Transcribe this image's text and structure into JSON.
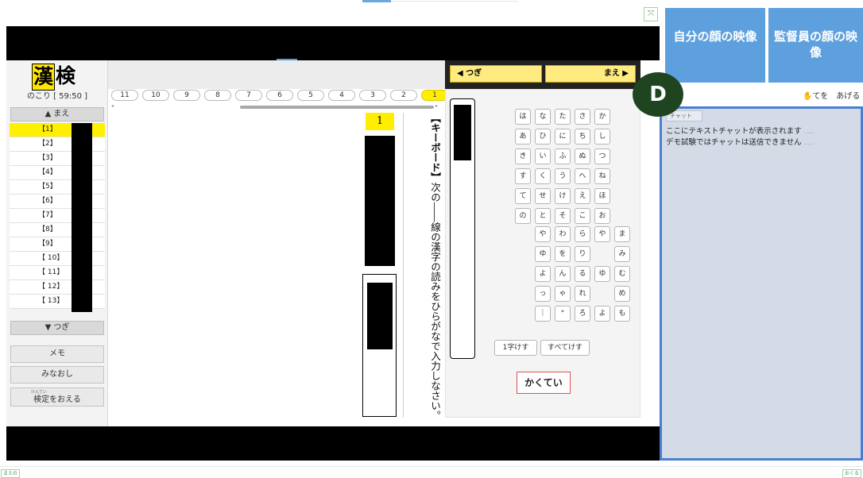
{
  "header": {
    "expand_icon": "⤧"
  },
  "left": {
    "logo": [
      "漢",
      "検"
    ],
    "timer": "のこり [ 59:50 ]",
    "prev_label": "▲ まえ",
    "next_label": "▼ つぎ",
    "questions": [
      "【1】",
      "【2】",
      "【3】",
      "【4】",
      "【5】",
      "【6】",
      "【7】",
      "【8】",
      "【9】",
      "【 10】",
      "【 11】",
      "【 12】",
      "【 13】"
    ],
    "memo_label": "メモ",
    "review_label": "みなおし",
    "finish_ruby": "けんてい",
    "finish_label": "検定をおえる"
  },
  "tabs": [
    "11",
    "10",
    "9",
    "8",
    "7",
    "6",
    "5",
    "4",
    "3",
    "2",
    "1"
  ],
  "question": {
    "number": "1",
    "keyboard_tag": "【キーボード】",
    "instruction": "次の――線の漢字の読みをひらがなで入力しなさい。"
  },
  "keyboard": {
    "next_label": "◀ つぎ",
    "prev_label": "まえ ▶",
    "rows_top": [
      [
        "は",
        "な",
        "た",
        "さ",
        "か",
        "あ"
      ],
      [
        "ひ",
        "に",
        "ち",
        "し",
        "き",
        "い"
      ],
      [
        "ふ",
        "ぬ",
        "つ",
        "す",
        "く",
        "う"
      ],
      [
        "へ",
        "ね",
        "て",
        "せ",
        "け",
        "え"
      ],
      [
        "ほ",
        "の",
        "と",
        "そ",
        "こ",
        "お"
      ]
    ],
    "rows_bottom": [
      [
        "や",
        "わ",
        "ら",
        "や",
        "ま"
      ],
      [
        "ゆ",
        "を",
        "り",
        "",
        "み"
      ],
      [
        "よ",
        "ん",
        "る",
        "ゆ",
        "む"
      ],
      [
        "っ",
        "ゃ",
        "れ",
        "",
        "め"
      ],
      [
        "｜",
        "°",
        "ろ",
        "よ",
        "も"
      ]
    ],
    "delete_one": "1字けす",
    "delete_all": "すべてけす",
    "confirm": "かくてい"
  },
  "right": {
    "video_self": "自分の顔の映像",
    "video_proctor": "監督員の顔の映像",
    "raise_hand": "✋てを　あげる",
    "badge": "D",
    "chat_tab": "チャット",
    "chat_lines": [
      "ここにテキストチャットが表示されます",
      "デモ試験ではチャットは送信できません"
    ],
    "chat_dots": "......"
  },
  "footer": {
    "left_btn": "まえの",
    "right_btn": "おくる"
  },
  "colors": {
    "accent_yellow": "#ffee00",
    "video_blue": "#5ea0dd",
    "chat_border": "#4a7fd0",
    "badge_green": "#1e4520"
  }
}
